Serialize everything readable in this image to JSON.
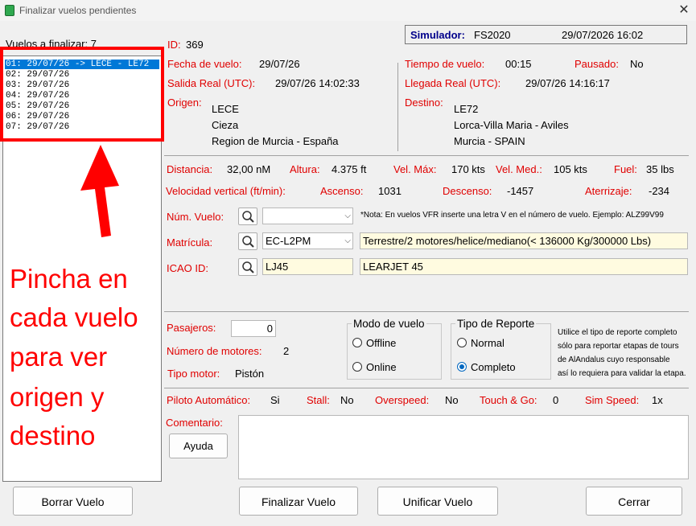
{
  "window": {
    "title": "Finalizar vuelos pendientes",
    "close_glyph": "✕"
  },
  "list": {
    "header": "Vuelos a finalizar: 7",
    "items": [
      "01: 29/07/26 -> LECE - LE72",
      "02: 29/07/26",
      "03: 29/07/26",
      "04: 29/07/26",
      "05: 29/07/26",
      "06: 29/07/26",
      "07: 29/07/26"
    ],
    "selected_index": 0
  },
  "annotation": {
    "lines": [
      "Pincha en",
      "cada vuelo",
      "para ver",
      "origen y",
      "destino"
    ],
    "color": "#ff0000"
  },
  "sim": {
    "label": "Simulador:",
    "value": "FS2020",
    "datetime": "29/07/2026 16:02"
  },
  "flight": {
    "id_label": "ID:",
    "id": "369",
    "fecha_label": "Fecha de vuelo:",
    "fecha": "29/07/26",
    "salida_label": "Salida Real (UTC):",
    "salida": "29/07/26 14:02:33",
    "origen_label": "Origen:",
    "origen": [
      "LECE",
      "Cieza",
      "Region de Murcia - España"
    ],
    "tiempo_label": "Tiempo de vuelo:",
    "tiempo": "00:15",
    "pausado_label": "Pausado:",
    "pausado": "No",
    "llegada_label": "Llegada Real (UTC):",
    "llegada": "29/07/26 14:16:17",
    "destino_label": "Destino:",
    "destino": [
      "LE72",
      "Lorca-Villa Maria - Aviles",
      "Murcia - SPAIN"
    ]
  },
  "stats": {
    "distancia_label": "Distancia:",
    "distancia": "32,00 nM",
    "altura_label": "Altura:",
    "altura": "4.375 ft",
    "velmax_label": "Vel. Máx:",
    "velmax": "170 kts",
    "velmed_label": "Vel. Med.:",
    "velmed": "105 kts",
    "fuel_label": "Fuel:",
    "fuel": "35 lbs",
    "vvert_label": "Velocidad vertical (ft/min):",
    "ascenso_label": "Ascenso:",
    "ascenso": "1031",
    "descenso_label": "Descenso:",
    "descenso": "-1457",
    "aterrizaje_label": "Aterrizaje:",
    "aterrizaje": "-234"
  },
  "form": {
    "num_vuelo_label": "Núm. Vuelo:",
    "num_vuelo_value": "",
    "nota": "*Nota: En vuelos VFR inserte una letra V en el número de vuelo. Ejemplo: ALZ99V99",
    "matricula_label": "Matrícula:",
    "matricula_value": "EC-L2PM",
    "matricula_desc": "Terrestre/2 motores/helice/mediano(< 136000 Kg/300000 Lbs)",
    "icao_label": "ICAO ID:",
    "icao_value": "LJ45",
    "icao_desc": "LEARJET 45"
  },
  "details": {
    "pasajeros_label": "Pasajeros:",
    "pasajeros_value": "0",
    "motores_label": "Número de motores:",
    "motores": "2",
    "tipo_motor_label": "Tipo motor:",
    "tipo_motor": "Pistón",
    "modo_title": "Modo de vuelo",
    "modo_offline": "Offline",
    "modo_online": "Online",
    "reporte_title": "Tipo de Reporte",
    "reporte_normal": "Normal",
    "reporte_completo": "Completo",
    "reporte_note": [
      "Utilice el tipo de reporte completo",
      "sólo para reportar etapas de tours",
      "de AlAndalus cuyo responsable",
      "así lo requiera para validar la etapa."
    ]
  },
  "flags": {
    "piloto_label": "Piloto Automático:",
    "piloto": "Si",
    "stall_label": "Stall:",
    "stall": "No",
    "overspeed_label": "Overspeed:",
    "overspeed": "No",
    "touchgo_label": "Touch & Go:",
    "touchgo": "0",
    "simspeed_label": "Sim Speed:",
    "simspeed": "1x"
  },
  "comment": {
    "label": "Comentario:",
    "help": "Ayuda",
    "value": ""
  },
  "buttons": {
    "borrar": "Borrar Vuelo",
    "finalizar": "Finalizar Vuelo",
    "unificar": "Unificar Vuelo",
    "cerrar": "Cerrar"
  },
  "colors": {
    "label_red": "#e00000",
    "sim_blue": "#00008b",
    "selection": "#0078d7",
    "field_yellow": "#fffbe0"
  }
}
